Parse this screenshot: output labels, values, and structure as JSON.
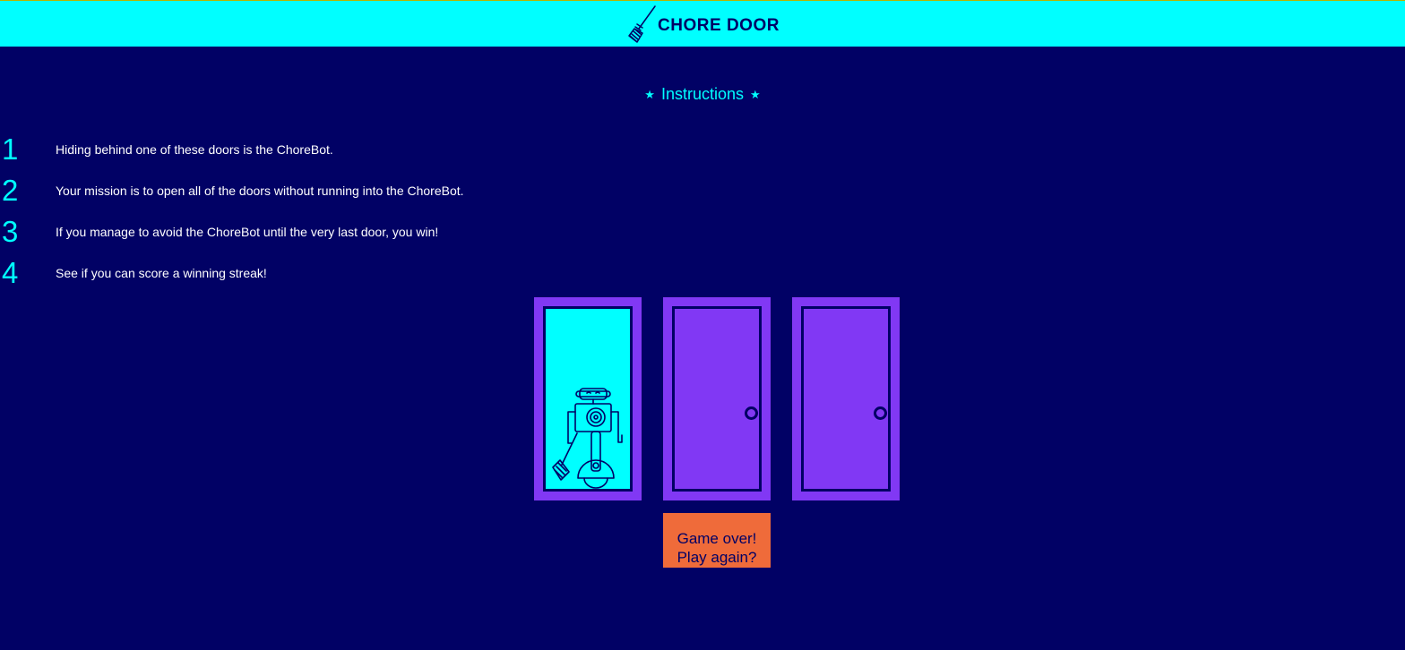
{
  "header": {
    "title": "CHORE DOOR",
    "logo_icon": "broom-icon"
  },
  "instructions": {
    "title": "Instructions",
    "star": "★",
    "steps": [
      {
        "number": "1",
        "text": "Hiding behind one of these doors is the ChoreBot."
      },
      {
        "number": "2",
        "text": "Your mission is to open all of the doors without running into the ChoreBot."
      },
      {
        "number": "3",
        "text": "If you manage to avoid the ChoreBot until the very last door, you win!"
      },
      {
        "number": "4",
        "text": "See if you can score a winning streak!"
      }
    ]
  },
  "doors": [
    {
      "state": "open",
      "content": "robot-icon"
    },
    {
      "state": "closed",
      "content": "door-knob"
    },
    {
      "state": "closed",
      "content": "door-knob"
    }
  ],
  "play_button": {
    "line1": "Game over!",
    "line2": "Play again?"
  },
  "colors": {
    "background": "#010165",
    "header": "#00ffff",
    "accent": "#00ffff",
    "door": "#8138f4",
    "button": "#ef6b3a",
    "text": "#ffffff"
  }
}
